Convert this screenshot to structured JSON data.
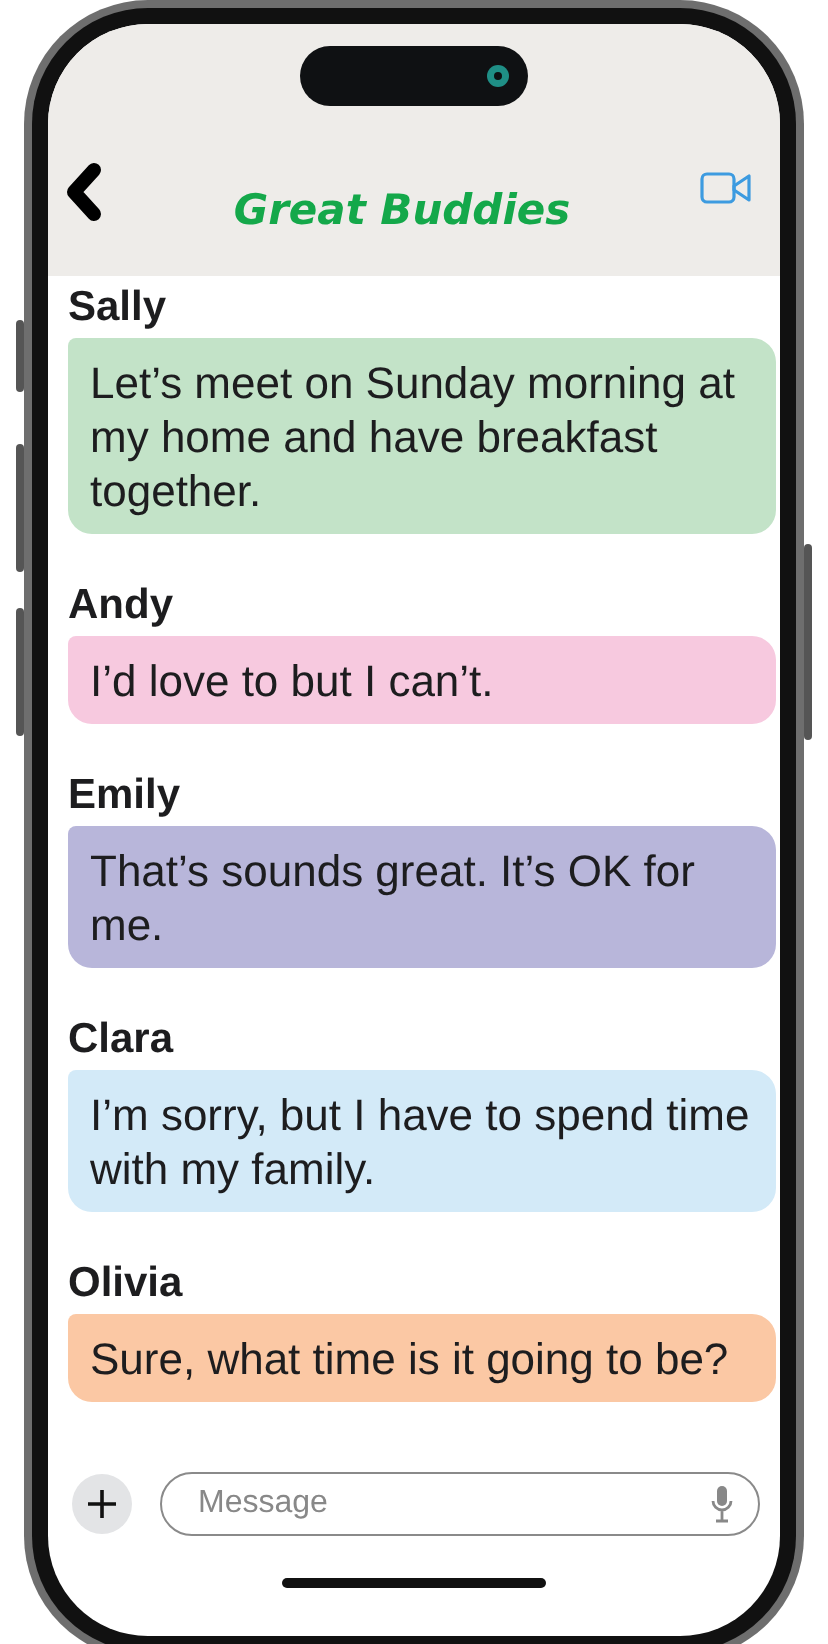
{
  "header": {
    "title": "Great Buddies"
  },
  "messages": [
    {
      "sender": "Sally",
      "text": "Let’s meet on Sunday morning at my home and have breakfast together.",
      "color": "#c3e3c8"
    },
    {
      "sender": "Andy",
      "text": "I’d love to but I can’t.",
      "color": "#f7c9df"
    },
    {
      "sender": "Emily",
      "text": "That’s sounds great. It’s OK for me.",
      "color": "#b8b6da"
    },
    {
      "sender": "Clara",
      "text": "I’m sorry, but I have to spend time with my family.",
      "color": "#d3eaf8"
    },
    {
      "sender": "Olivia",
      "text": "Sure, what time is it going to be?",
      "color": "#fbc8a4"
    }
  ],
  "composer": {
    "placeholder": "Message"
  }
}
